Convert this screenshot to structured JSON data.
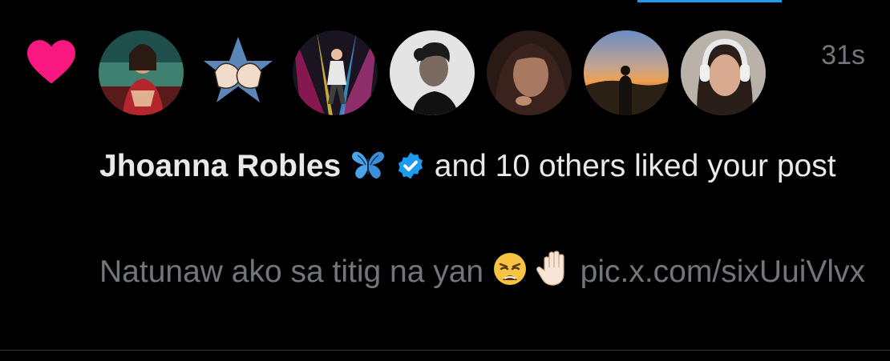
{
  "notification": {
    "type_icon": "heart-icon",
    "timestamp": "31s",
    "avatars": [
      {
        "name": "avatar-1",
        "color": "#8c2b2b"
      },
      {
        "name": "avatar-2",
        "color": "#4b7fb0"
      },
      {
        "name": "avatar-3",
        "color": "#2a2a2a"
      },
      {
        "name": "avatar-4",
        "color": "#d8d8d8"
      },
      {
        "name": "avatar-5",
        "color": "#5a3a30"
      },
      {
        "name": "avatar-6",
        "color": "#e9a266"
      },
      {
        "name": "avatar-7",
        "color": "#b89a84"
      }
    ],
    "username": "Jhoanna Robles",
    "username_emoji": "butterfly-icon",
    "verified": true,
    "action_text": " and 10 others liked your post",
    "post_preview": "Natunaw ako sa titig na yan",
    "preview_emojis": [
      "weary-face-icon",
      "raised-hand-icon"
    ],
    "post_link": "pic.x.com/sixUuiVlvx"
  },
  "colors": {
    "background": "#000000",
    "heart": "#f91880",
    "text_primary": "#e7e9ea",
    "text_secondary": "#71767b",
    "verified": "#1d9bf0",
    "divider": "#2f3336"
  }
}
